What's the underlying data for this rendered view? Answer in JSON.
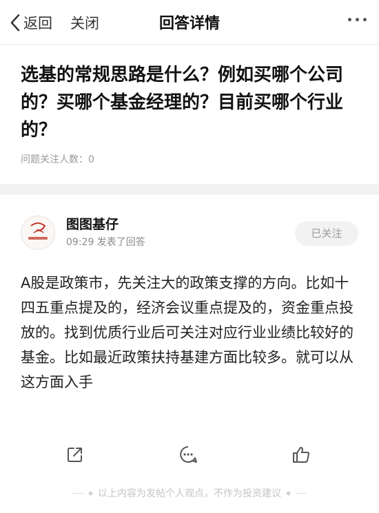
{
  "navbar": {
    "back_label": "返回",
    "close_label": "关闭",
    "title": "回答详情"
  },
  "question": {
    "title": "选基的常规思路是什么？例如买哪个公司的？买哪个基金经理的？目前买哪个行业的？",
    "followers_label": "问题关注人数：",
    "followers_count": "0"
  },
  "answer": {
    "author": {
      "name": "图图基仔",
      "meta": "09:29 发表了回答",
      "follow_label": "已关注"
    },
    "body": "A股是政策市，先关注大的政策支撑的方向。比如十四五重点提及的，经济会议重点提及的，资金重点投放的。找到优质行业后可关注对应行业业绩比较好的基金。比如最近政策扶持基建方面比较多。就可以从这方面入手"
  },
  "actions": {
    "icons": [
      "share-icon",
      "comment-icon",
      "like-icon"
    ]
  },
  "footer": {
    "note": "以上内容为发帖个人观点，不作为投资建议"
  },
  "colors": {
    "text": "#222222",
    "muted": "#999999",
    "band": "#f2f2f2",
    "avatar_accent": "#c0392b"
  }
}
